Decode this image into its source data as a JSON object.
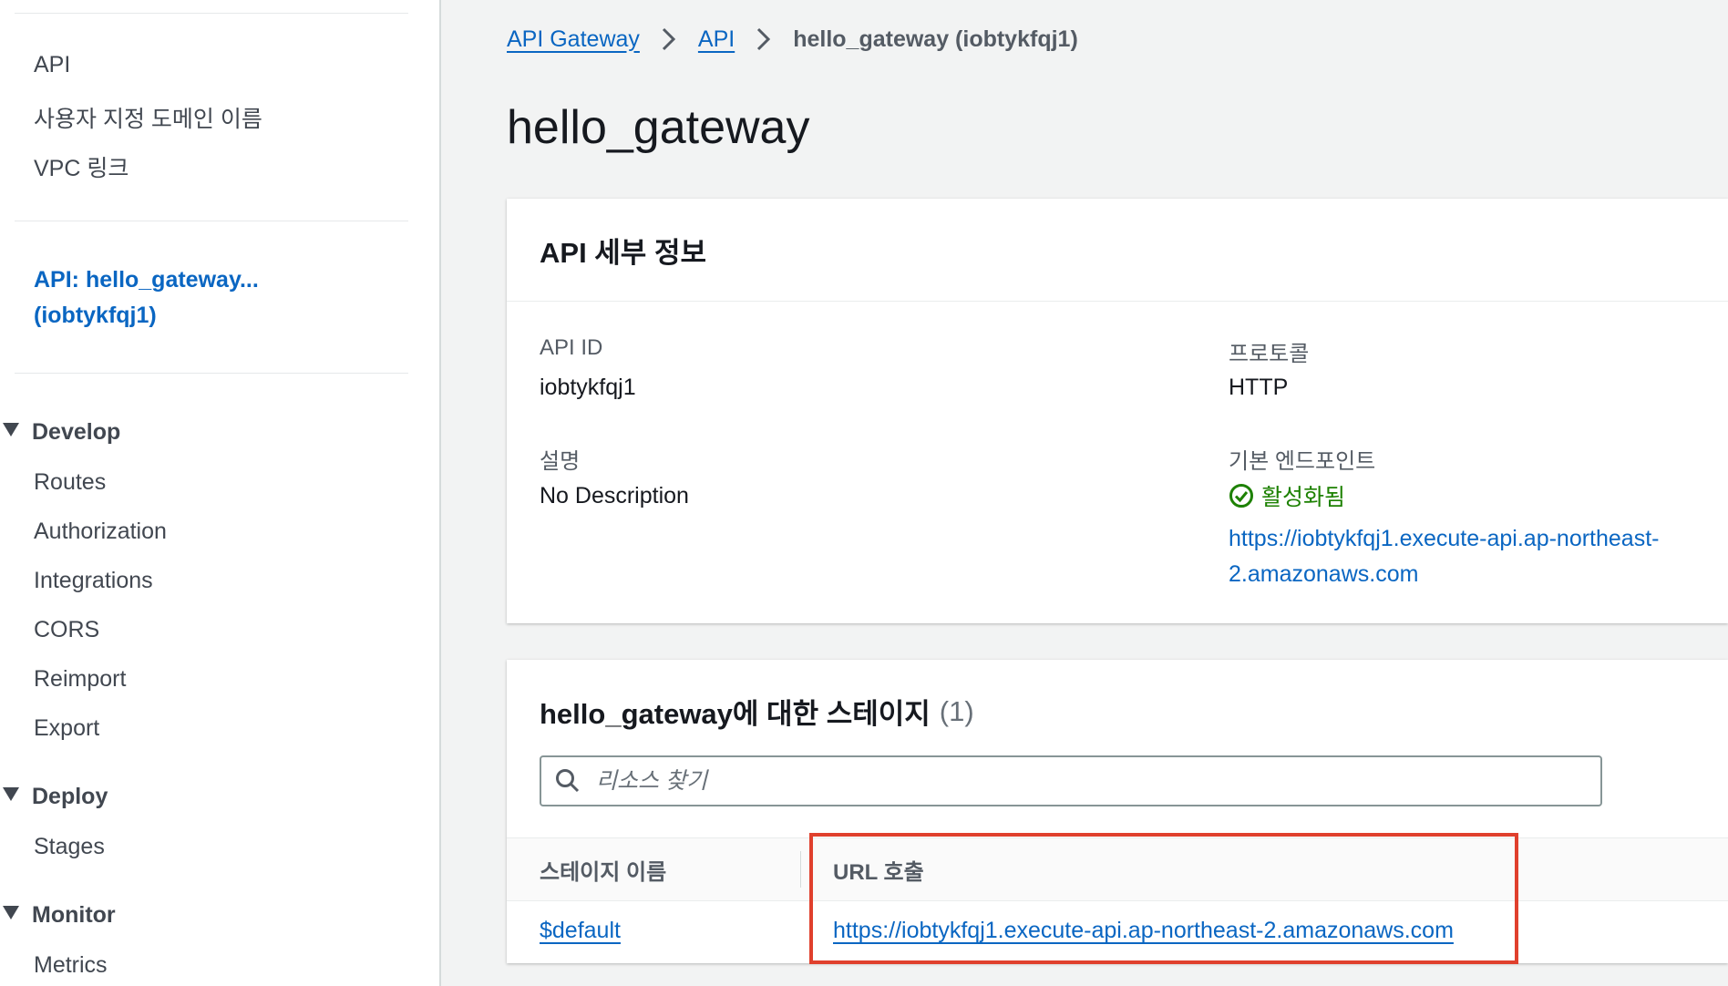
{
  "sidebar": {
    "top_items": [
      "API",
      "사용자 지정 도메인 이름",
      "VPC 링크"
    ],
    "active_api": {
      "line1": "API: hello_gateway...",
      "line2": "(iobtykfqj1)"
    },
    "sections": [
      {
        "label": "Develop",
        "items": [
          "Routes",
          "Authorization",
          "Integrations",
          "CORS",
          "Reimport",
          "Export"
        ]
      },
      {
        "label": "Deploy",
        "items": [
          "Stages"
        ]
      },
      {
        "label": "Monitor",
        "items": [
          "Metrics"
        ]
      }
    ]
  },
  "breadcrumb": {
    "items": [
      "API Gateway",
      "API"
    ],
    "current": "hello_gateway (iobtykfqj1)"
  },
  "page_title": "hello_gateway",
  "details": {
    "title": "API 세부 정보",
    "api_id_label": "API ID",
    "api_id_value": "iobtykfqj1",
    "protocol_label": "프로토콜",
    "protocol_value": "HTTP",
    "description_label": "설명",
    "description_value": "No Description",
    "endpoint_label": "기본 엔드포인트",
    "endpoint_status": "활성화됨",
    "endpoint_url_line1": "https://iobtykfqj1.execute-api.ap-northeast-",
    "endpoint_url_line2": "2.amazonaws.com"
  },
  "stages": {
    "title": "hello_gateway에 대한 스테이지",
    "count": "(1)",
    "search_placeholder": "리소스 찾기",
    "columns": [
      "스테이지 이름",
      "URL 호출"
    ],
    "rows": [
      {
        "stage": "$default",
        "url": "https://iobtykfqj1.execute-api.ap-northeast-2.amazonaws.com"
      }
    ]
  },
  "colors": {
    "link": "#0a66c2",
    "success": "#1d8102",
    "highlight": "#e0402d"
  }
}
